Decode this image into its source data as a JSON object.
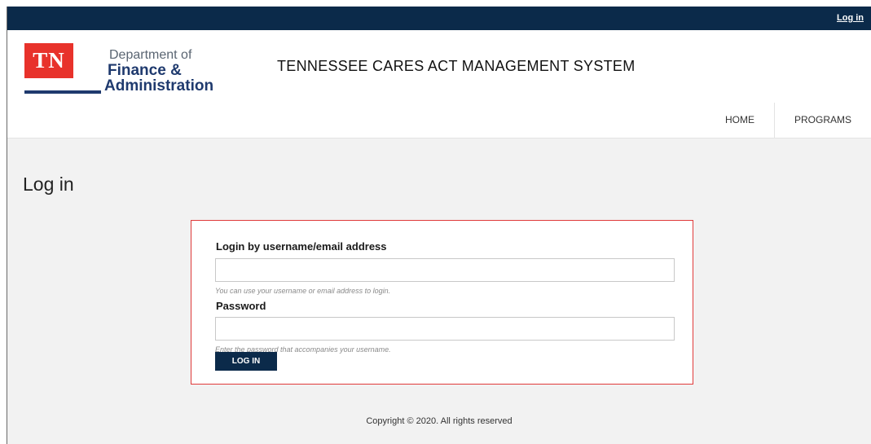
{
  "topbar": {
    "login_link": "Log in"
  },
  "logo": {
    "tn": "TN",
    "line1": "Department of",
    "line2": "Finance &",
    "line3": "Administration"
  },
  "site_title": "TENNESSEE CARES ACT MANAGEMENT SYSTEM",
  "nav": {
    "home": "HOME",
    "programs": "PROGRAMS"
  },
  "page_title": "Log in",
  "form": {
    "username_label": "Login by username/email address",
    "username_value": "",
    "username_hint": "You can use your username or email address to login.",
    "password_label": "Password",
    "password_value": "",
    "password_hint": "Enter the password that accompanies your username.",
    "submit_label": "LOG IN"
  },
  "footer": {
    "copyright": "Copyright © 2020. All rights reserved"
  },
  "colors": {
    "navy": "#0b2a4a",
    "brand_red": "#e8322b",
    "box_border": "#e03a3a"
  }
}
